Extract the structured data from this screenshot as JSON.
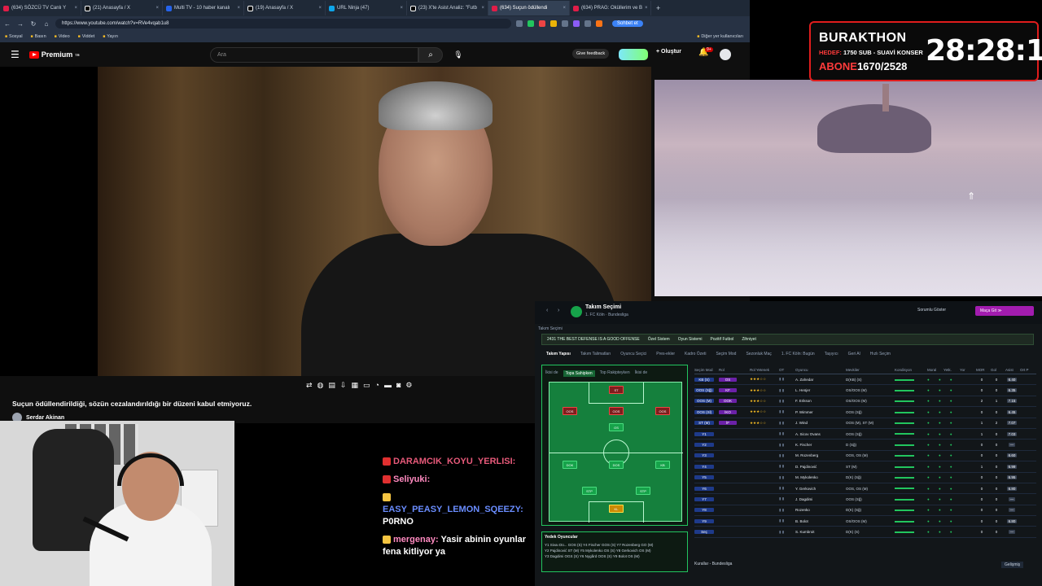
{
  "browser": {
    "tabs": [
      {
        "title": "(634) SÖZCÜ TV Canlı Y"
      },
      {
        "title": "(21) Anasayfa / X"
      },
      {
        "title": "Multi TV - 10 haber kanalı"
      },
      {
        "title": "(19) Anasayfa / X"
      },
      {
        "title": "URL Ninja (47)"
      },
      {
        "title": "(23) X'te Asist Analiz: \"Futb"
      },
      {
        "title": "(634) Suçun ödüllendi"
      },
      {
        "title": "(634) PRAG: Oküllerim ve B"
      }
    ],
    "new_tab": "+",
    "url": "https://www.youtube.com/watch?v=RVe4vqab1u8",
    "chat_button": "Sohbet et",
    "bookmarks": [
      "Sosyal",
      "Basın",
      "Video",
      "Viddet",
      "Yayın"
    ],
    "bookmarks_right": "Diğer yer kullanıcıları"
  },
  "youtube": {
    "logo": "Premium",
    "logo_sup": "TR",
    "search_placeholder": "Ara",
    "feedback": "Give feedback",
    "create": "Oluştur",
    "notif_count": "9+",
    "video_title": "Suçun ödüllendirildiği, sözün cezalandırıldığı bir düzeni kabul etmiyoruz.",
    "channel": "Serdar Akinan"
  },
  "subathon": {
    "title": "BURAKTHON",
    "line1_prefix": "HEDEF:",
    "line1": "1750 SUB - SUAVİ KONSER",
    "line2_prefix": "ABONE",
    "line2": "1670/2528",
    "timer": "28:28:13"
  },
  "chat": {
    "messages": [
      {
        "user": "DARAMCIK_KOYU_YERLISI:",
        "text": "",
        "color": "red"
      },
      {
        "user": "Seliyuki:",
        "text": "",
        "color": "pink"
      },
      {
        "user": "EASY_PEASY_LEMON_SQEEZY:",
        "text": "P0RNO",
        "color": "blue"
      },
      {
        "user": "mergenay:",
        "text": "Yasir abinin oyunlar fena kitliyor ya",
        "color": "pink"
      }
    ]
  },
  "fm": {
    "title": "Takım Seçimi",
    "subtitle": "1. FC Köln · Bundesliga",
    "staff_button": "Sorumlu Göster",
    "continue": "Maça Git",
    "sub_label": "Takım Seçimi",
    "tactic_chips": [
      "2431 THE BEST DEFENSE IS A GOOD OFFENSE",
      "Özel Sistem",
      "Oyun Sistemi",
      "Pozitif Futbol",
      "Zihniyet"
    ],
    "tabs": [
      "Takım Yapısı",
      "Takım Talimatları",
      "Oyuncu Seçici",
      "Pres-ekler",
      "Kadro Özeti",
      "Seçim Mod",
      "Sezonluk Maç",
      "1. FC Köln: Bugün",
      "Taşıyıcı",
      "Geri Al",
      "Hızlı Seçim"
    ],
    "pitch_tabs": [
      "İkisi de",
      "Topa Sahipken",
      "Top Rakipteyken",
      "İkisi de"
    ],
    "coach_title": "Yedek Oyuncular",
    "coach_rows": [
      "Y1 Sivaı Dü... GOS (S)   Y4 Fischer   GOS (S)   Y7 Rozenberg GO (M)",
      "Y2 Pajdinović ST (M)   Y5 Mykolenko  OS (S)   Y8 Gerkovich  OS (M)",
      "Y3 Dagdimi  OGS (S)   Y6 Nygård  OOS (S)   Y9 Bolot  OS (M)"
    ],
    "table_head": [
      "Seçim Mod",
      "Rol",
      "Rol Yetenek",
      "OT",
      "Oyuncu",
      "Mevkiler",
      "Kondisyon",
      "Moral",
      "Yetk.",
      "Yor",
      "MOR",
      "Gol",
      "Asist",
      "Ort P"
    ],
    "rows": [
      {
        "pos": "KB (S)",
        "role": "OS",
        "stars": "★★★☆☆",
        "name": "A. Zahedar",
        "post": "D(KB) (S)",
        "v1": "0",
        "v2": "0",
        "rt": "6.40"
      },
      {
        "pos": "OOS (Sğ)",
        "role": "KF",
        "stars": "★★★☆☆",
        "name": "L. Heüjer",
        "post": "OS/OOS (M)",
        "v1": "0",
        "v2": "0",
        "rt": "6.35"
      },
      {
        "pos": "OOS (M)",
        "role": "OOK",
        "stars": "★★★☆☆",
        "name": "F. Erikson",
        "post": "OS/OOS (M)",
        "v1": "2",
        "v2": "1",
        "rt": "7.15"
      },
      {
        "pos": "OOS (Sl)",
        "role": "İKO",
        "stars": "★★★☆☆",
        "name": "P. Wimmer",
        "post": "OOS (Sğ)",
        "v1": "0",
        "v2": "0",
        "rt": "6.45"
      },
      {
        "pos": "ST (M)",
        "role": "İF",
        "stars": "★★★☆☆",
        "name": "J. Wind",
        "post": "OOS (M), ST (M)",
        "v1": "1",
        "v2": "2",
        "rt": "7.07"
      },
      {
        "pos": "Y1",
        "role": "",
        "stars": "",
        "name": "A. Sicov Ovans",
        "post": "OOS (Sğ)",
        "v1": "1",
        "v2": "0",
        "rt": "7.03"
      },
      {
        "pos": "Y2",
        "role": "",
        "stars": "",
        "name": "K. Fischer",
        "post": "D (Sğ)",
        "v1": "0",
        "v2": "0",
        "rt": "—"
      },
      {
        "pos": "Y3",
        "role": "",
        "stars": "",
        "name": "M. Rozenberg",
        "post": "OOS, OS (M)",
        "v1": "0",
        "v2": "0",
        "rt": "6.60"
      },
      {
        "pos": "Y4",
        "role": "",
        "stars": "",
        "name": "D. Pajdinović",
        "post": "ST (M)",
        "v1": "1",
        "v2": "0",
        "rt": "6.99"
      },
      {
        "pos": "Y5",
        "role": "",
        "stars": "",
        "name": "M. Mykolenko",
        "post": "D(K) (Sğ)",
        "v1": "0",
        "v2": "0",
        "rt": "6.95"
      },
      {
        "pos": "Y6",
        "role": "",
        "stars": "",
        "name": "Y. Gerkovich",
        "post": "OOS, OS (M)",
        "v1": "0",
        "v2": "0",
        "rt": "6.80"
      },
      {
        "pos": "Y7",
        "role": "",
        "stars": "",
        "name": "J. Dagdimi",
        "post": "OOS (Sğ)",
        "v1": "0",
        "v2": "0",
        "rt": "—"
      },
      {
        "pos": "Y8",
        "role": "",
        "stars": "",
        "name": "Rozenko",
        "post": "D(K) (Sğ)",
        "v1": "0",
        "v2": "0",
        "rt": "—"
      },
      {
        "pos": "Y9",
        "role": "",
        "stars": "",
        "name": "B. Bolot",
        "post": "OS/OOS (M)",
        "v1": "0",
        "v2": "0",
        "rt": "6.80"
      },
      {
        "pos": "Seç",
        "role": "",
        "stars": "",
        "name": "S. Kumbroit",
        "post": "D(K) (S)",
        "v1": "0",
        "v2": "0",
        "rt": "—"
      }
    ],
    "footer": "Kurallar - Bundesliga",
    "footer_button": "Gelişmiş",
    "pitch_players": [
      {
        "label": "ST",
        "kind": "r"
      },
      {
        "label": "OOS",
        "kind": "r"
      },
      {
        "label": "OOS",
        "kind": "r"
      },
      {
        "label": "OOS",
        "kind": "r"
      },
      {
        "label": "OS",
        "kind": "g"
      },
      {
        "label": "DOK",
        "kind": "g"
      },
      {
        "label": "DOS",
        "kind": "g"
      },
      {
        "label": "KB",
        "kind": "g"
      },
      {
        "label": "STP",
        "kind": "g"
      },
      {
        "label": "STP",
        "kind": "g"
      },
      {
        "label": "KL",
        "kind": "y"
      }
    ]
  }
}
